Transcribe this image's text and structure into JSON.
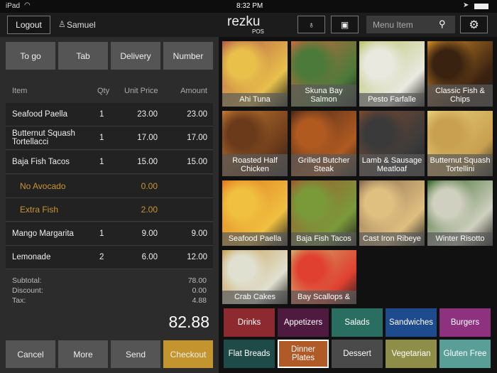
{
  "status": {
    "device": "iPad",
    "time": "8:32 PM"
  },
  "header": {
    "logout": "Logout",
    "user": "Samuel",
    "logo": "rezku",
    "logo_sub": "POS",
    "search_placeholder": "Menu Item"
  },
  "order_types": [
    "To go",
    "Tab",
    "Delivery",
    "Number"
  ],
  "table": {
    "headers": {
      "item": "Item",
      "qty": "Qty",
      "unit": "Unit Price",
      "amount": "Amount"
    },
    "rows": [
      {
        "item": "Seafood Paella",
        "qty": "1",
        "unit": "23.00",
        "amount": "23.00"
      },
      {
        "item": "Butternut Squash Tortellacci",
        "qty": "1",
        "unit": "17.00",
        "amount": "17.00"
      },
      {
        "item": "Baja Fish Tacos",
        "qty": "1",
        "unit": "15.00",
        "amount": "15.00"
      },
      {
        "item": "No Avocado",
        "qty": "",
        "unit": "0.00",
        "amount": "",
        "modifier": true
      },
      {
        "item": "Extra Fish",
        "qty": "",
        "unit": "2.00",
        "amount": "",
        "modifier": true
      },
      {
        "item": "Mango Margarita",
        "qty": "1",
        "unit": "9.00",
        "amount": "9.00"
      },
      {
        "item": "Lemonade",
        "qty": "2",
        "unit": "6.00",
        "amount": "12.00"
      }
    ]
  },
  "totals": {
    "subtotal_label": "Subtotal:",
    "subtotal": "78.00",
    "discount_label": "Discount:",
    "discount": "0.00",
    "tax_label": "Tax:",
    "tax": "4.88",
    "total": "82.88"
  },
  "actions": [
    "Cancel",
    "More",
    "Send",
    "Checkout"
  ],
  "menu_items": [
    {
      "label": "Ahi Tuna",
      "colors": [
        "#b55a4a",
        "#e8c04a"
      ]
    },
    {
      "label": "Skuna Bay Salmon",
      "colors": [
        "#c76a3e",
        "#4c7a3a"
      ]
    },
    {
      "label": "Pesto Farfalle",
      "colors": [
        "#b9c46a",
        "#e9e9e0"
      ]
    },
    {
      "label": "Classic Fish & Chips",
      "colors": [
        "#d08a2a",
        "#3a2210"
      ]
    },
    {
      "label": "Roasted Half Chicken",
      "colors": [
        "#c07830",
        "#6a3a1a"
      ]
    },
    {
      "label": "Grilled Butcher Steak",
      "colors": [
        "#4a2a1a",
        "#b05a20"
      ]
    },
    {
      "label": "Lamb & Sausage Meatloaf",
      "colors": [
        "#7a4a30",
        "#3a3a3a"
      ]
    },
    {
      "label": "Butternut Squash Tortellini",
      "colors": [
        "#e8d07a",
        "#c8a050"
      ]
    },
    {
      "label": "Seafood Paella",
      "colors": [
        "#e07a20",
        "#f0c040"
      ]
    },
    {
      "label": "Baja Fish Tacos",
      "colors": [
        "#a05a30",
        "#7a9a3a"
      ]
    },
    {
      "label": "Cast Iron Ribeye",
      "colors": [
        "#8a6a50",
        "#e0c080"
      ]
    },
    {
      "label": "Winter Risotto",
      "colors": [
        "#3a6a2a",
        "#d0d0c0"
      ]
    },
    {
      "label": "Crab Cakes",
      "colors": [
        "#c8a050",
        "#e0e0d0"
      ]
    },
    {
      "label": "Bay Scallops &",
      "colors": [
        "#d0b070",
        "#e04030"
      ]
    }
  ],
  "categories": [
    {
      "label": "Drinks",
      "color": "#8c2a30"
    },
    {
      "label": "Appetizers",
      "color": "#4e1a40"
    },
    {
      "label": "Salads",
      "color": "#2a6e62"
    },
    {
      "label": "Sandwiches",
      "color": "#1e4a8e"
    },
    {
      "label": "Burgers",
      "color": "#8e3280"
    },
    {
      "label": "Flat Breads",
      "color": "#1e4a48"
    },
    {
      "label": "Dinner Plates",
      "color": "#b05a28",
      "selected": true
    },
    {
      "label": "Dessert",
      "color": "#4a4a4a"
    },
    {
      "label": "Vegetarian",
      "color": "#8e8e48"
    },
    {
      "label": "Gluten Free",
      "color": "#5a9e98"
    }
  ],
  "accent": "#c4952e"
}
